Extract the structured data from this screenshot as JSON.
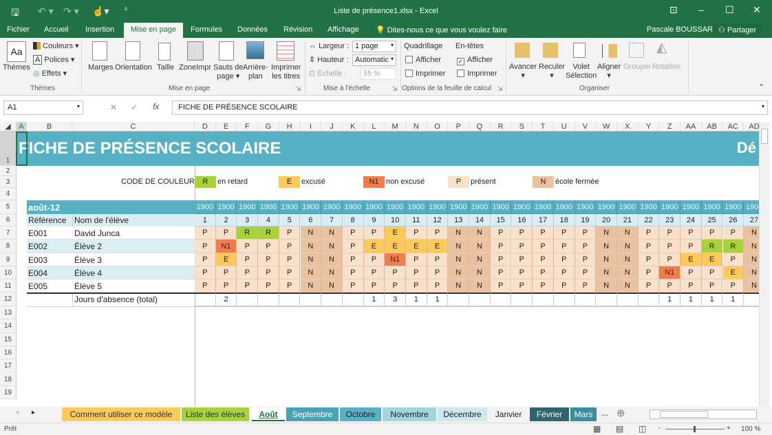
{
  "window": {
    "title": "Liste de présence1.xlsx - Excel",
    "user": "Pascale BOUSSARD",
    "share": "Partager"
  },
  "menu": [
    "Fichier",
    "Accueil",
    "Insertion",
    "Mise en page",
    "Formules",
    "Données",
    "Révision",
    "Affichage"
  ],
  "menu_active": "Mise en page",
  "tellme": "Dites-nous ce que vous voulez faire",
  "ribbon": {
    "themes": {
      "themes": "Thèmes",
      "colors": "Couleurs",
      "fonts": "Polices",
      "effects": "Effets",
      "group": "Thèmes"
    },
    "page_setup": {
      "margins": "Marges",
      "orientation": "Orientation",
      "size": "Taille",
      "print_area": "ZoneImpr",
      "breaks_1": "Sauts de",
      "breaks_2": "page",
      "background_1": "Arrière-",
      "background_2": "plan",
      "titles_1": "Imprimer",
      "titles_2": "les titres",
      "group": "Mise en page"
    },
    "scale": {
      "width_label": "Largeur :",
      "width_value": "1 page",
      "height_label": "Hauteur :",
      "height_value": "Automatic",
      "scale_label": "Échelle :",
      "scale_value": "55 %",
      "group": "Mise à l'échelle"
    },
    "sheet_options": {
      "gridlines": "Quadrillage",
      "headings": "En-têtes",
      "view": "Afficher",
      "print": "Imprimer",
      "gridlines_view": false,
      "gridlines_print": false,
      "headings_view": true,
      "headings_print": false,
      "group": "Options de la feuille de calcul"
    },
    "arrange": {
      "forward": "Avancer",
      "backward": "Reculer",
      "pane_1": "Volet",
      "pane_2": "Sélection",
      "align": "Aligner",
      "group_btn": "Grouper",
      "rotate": "Rotation",
      "group": "Organiser"
    }
  },
  "formula_bar": {
    "name_box": "A1",
    "formula": "FICHE DE PRÉSENCE SCOLAIRE"
  },
  "columns": [
    "A",
    "B",
    "C",
    "D",
    "E",
    "F",
    "G",
    "H",
    "I",
    "J",
    "K",
    "L",
    "M",
    "N",
    "O",
    "P",
    "Q",
    "R",
    "S",
    "T",
    "U",
    "V",
    "W",
    "X",
    "Y",
    "Z",
    "AA",
    "AB",
    "AC",
    "AD"
  ],
  "rows": [
    "1",
    "2",
    "3",
    "4",
    "5",
    "6",
    "7",
    "8",
    "9",
    "10",
    "11",
    "12",
    "13",
    "14",
    "15",
    "16",
    "17",
    "18",
    "19"
  ],
  "sheet": {
    "title": "FICHE DE PRÉSENCE SCOLAIRE",
    "title_right": "Dé",
    "legend_label": "CODE DE COULEURS",
    "legend": [
      {
        "code": "R",
        "label": "en retard"
      },
      {
        "code": "E",
        "label": "excusé"
      },
      {
        "code": "N1",
        "label": "non excusé"
      },
      {
        "code": "P",
        "label": "présent"
      },
      {
        "code": "N",
        "label": "école fermée"
      }
    ],
    "month": "août-12",
    "year_label": "1900",
    "ref_header": "Référence",
    "name_header": "Nom de l'élève",
    "days": [
      "1",
      "2",
      "3",
      "4",
      "5",
      "6",
      "7",
      "8",
      "9",
      "10",
      "11",
      "12",
      "13",
      "14",
      "15",
      "16",
      "17",
      "18",
      "19",
      "20",
      "21",
      "22",
      "23",
      "24",
      "25",
      "26",
      "27"
    ],
    "students": [
      {
        "ref": "E001",
        "name": "David Junca",
        "marks": [
          "P",
          "P",
          "R",
          "R",
          "P",
          "N",
          "N",
          "P",
          "P",
          "E",
          "P",
          "P",
          "N",
          "N",
          "P",
          "P",
          "P",
          "P",
          "P",
          "N",
          "N",
          "P",
          "P",
          "P",
          "P",
          "P",
          "N"
        ]
      },
      {
        "ref": "E002",
        "name": "Élève 2",
        "marks": [
          "P",
          "N1",
          "P",
          "P",
          "P",
          "N",
          "N",
          "P",
          "E",
          "E",
          "E",
          "E",
          "N",
          "N",
          "P",
          "P",
          "P",
          "P",
          "P",
          "N",
          "N",
          "P",
          "P",
          "P",
          "R",
          "R",
          "N"
        ]
      },
      {
        "ref": "E003",
        "name": "Élève 3",
        "marks": [
          "P",
          "E",
          "P",
          "P",
          "P",
          "N",
          "N",
          "P",
          "P",
          "N1",
          "P",
          "P",
          "N",
          "N",
          "P",
          "P",
          "P",
          "P",
          "P",
          "N",
          "N",
          "P",
          "P",
          "E",
          "E",
          "P",
          "N"
        ]
      },
      {
        "ref": "E004",
        "name": "Élève 4",
        "marks": [
          "P",
          "P",
          "P",
          "P",
          "P",
          "N",
          "N",
          "P",
          "P",
          "P",
          "P",
          "P",
          "N",
          "N",
          "P",
          "P",
          "P",
          "P",
          "P",
          "N",
          "N",
          "P",
          "N1",
          "P",
          "P",
          "E",
          "N"
        ]
      },
      {
        "ref": "E005",
        "name": "Élève 5",
        "marks": [
          "P",
          "P",
          "P",
          "P",
          "P",
          "N",
          "N",
          "P",
          "P",
          "P",
          "P",
          "P",
          "N",
          "N",
          "P",
          "P",
          "P",
          "P",
          "P",
          "N",
          "N",
          "P",
          "P",
          "P",
          "P",
          "P",
          "N"
        ]
      }
    ],
    "total_label": "Jours d'absence (total)",
    "totals": [
      "",
      "2",
      "",
      "",
      "",
      "",
      "",
      "",
      "1",
      "3",
      "1",
      "1",
      "",
      "",
      "",
      "",
      "",
      "",
      "",
      "",
      "",
      "",
      "1",
      "1",
      "1",
      "1",
      ""
    ]
  },
  "code_colors": {
    "R": "#a6d23c",
    "E": "#fcc95b",
    "N1": "#f07d50",
    "P": "#f9e0ca",
    "N": "#eac29f"
  },
  "accent": "#56b1c4",
  "tabs": [
    {
      "label": "Comment utiliser ce modèle",
      "bg": "#fcc95b",
      "fg": "#333"
    },
    {
      "label": "Liste des élèves",
      "bg": "#a6d23c",
      "fg": "#333"
    },
    {
      "label": "Août",
      "bg": "#ffffff",
      "fg": "#217346",
      "active": true
    },
    {
      "label": "Septembre",
      "bg": "#4aa3b5",
      "fg": "#fff"
    },
    {
      "label": "Octobre",
      "bg": "#56b1c4",
      "fg": "#222"
    },
    {
      "label": "Novembre",
      "bg": "#9fd4e0",
      "fg": "#222"
    },
    {
      "label": "Décembre",
      "bg": "#cde8ef",
      "fg": "#222"
    },
    {
      "label": "Janvier",
      "bg": "#f3f3f3",
      "fg": "#222"
    },
    {
      "label": "Février",
      "bg": "#2e6470",
      "fg": "#fff"
    },
    {
      "label": "Mars",
      "bg": "#3a8ea0",
      "fg": "#fff"
    }
  ],
  "tabs_more": "...",
  "status": {
    "ready": "Prêt",
    "zoom": "100 %"
  }
}
